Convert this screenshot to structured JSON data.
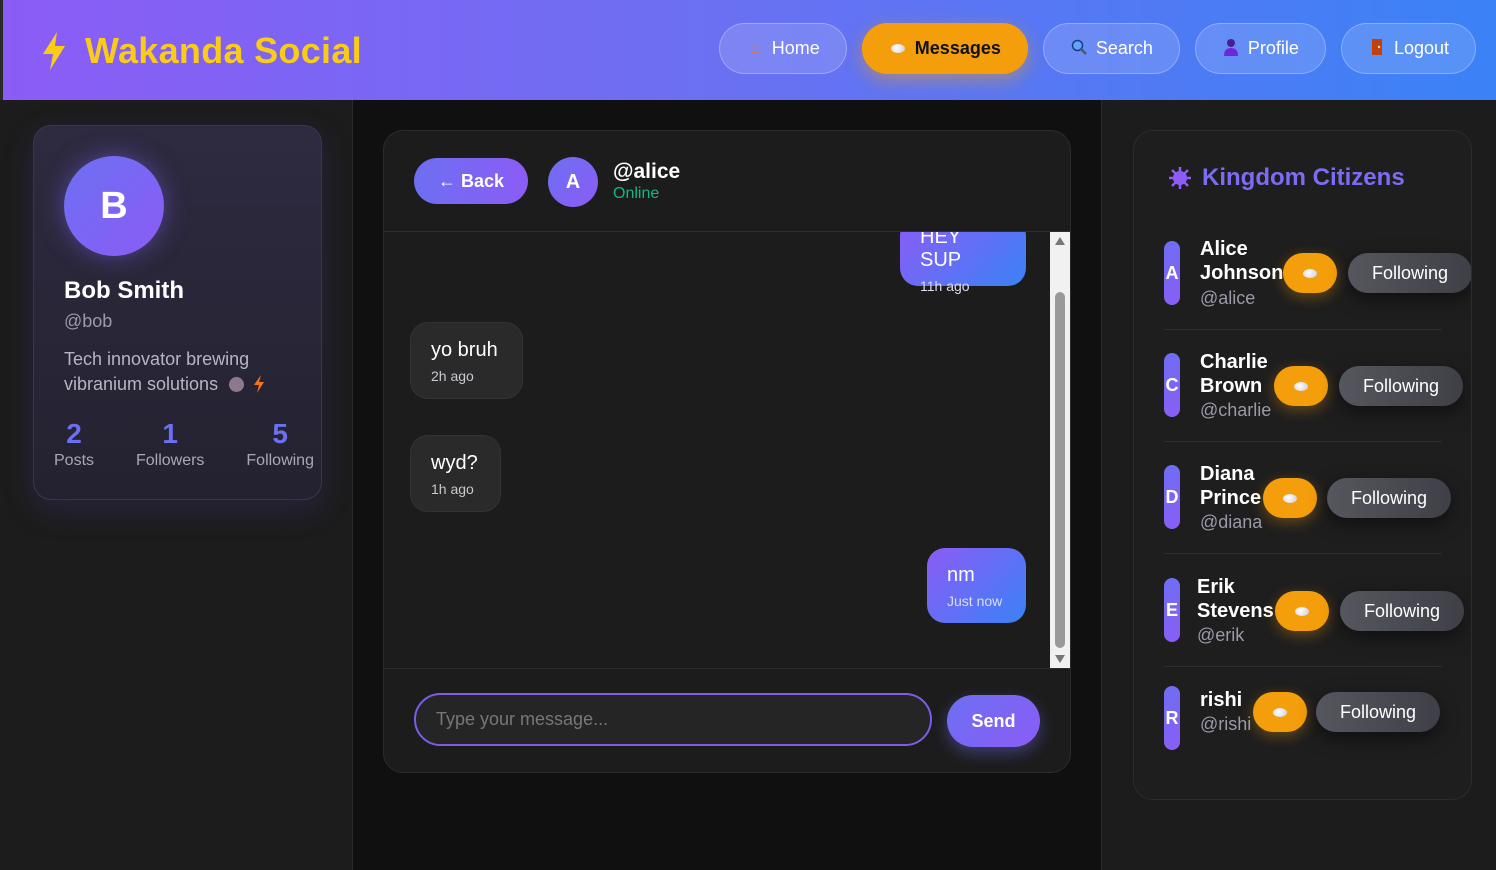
{
  "app": {
    "title": "Wakanda Social"
  },
  "nav": {
    "home": {
      "icon": "house-icon",
      "label": "Home"
    },
    "messages": {
      "icon": "speech-bubble-icon",
      "label": "Messages"
    },
    "search": {
      "icon": "magnifier-icon",
      "label": "Search"
    },
    "profile": {
      "icon": "person-icon",
      "label": "Profile"
    },
    "logout": {
      "icon": "door-icon",
      "label": "Logout"
    }
  },
  "profile": {
    "avatar_letter": "B",
    "name": "Bob Smith",
    "handle": "@bob",
    "bio": "Tech innovator brewing vibranium solutions",
    "stats": {
      "posts": {
        "value": "2",
        "label": "Posts"
      },
      "followers": {
        "value": "1",
        "label": "Followers"
      },
      "following": {
        "value": "5",
        "label": "Following"
      }
    }
  },
  "chat": {
    "back_label": "← Back",
    "avatar_letter": "A",
    "username": "@alice",
    "status": "Online",
    "messages": [
      {
        "direction": "out",
        "text": "HEY SUP",
        "time": "11h ago"
      },
      {
        "direction": "in",
        "text": "yo bruh",
        "time": "2h ago"
      },
      {
        "direction": "in",
        "text": "wyd?",
        "time": "1h ago"
      },
      {
        "direction": "out",
        "text": "nm",
        "time": "Just now"
      }
    ],
    "input_placeholder": "Type your message...",
    "input_value": "",
    "send_label": "Send"
  },
  "citizens": {
    "title": "Kingdom Citizens",
    "list": [
      {
        "letter": "A",
        "name_line1": "Alice",
        "name_line2": "Johnson",
        "handle": "@alice",
        "follow_label": "Following"
      },
      {
        "letter": "C",
        "name_line1": "Charlie",
        "name_line2": "Brown",
        "handle": "@charlie",
        "follow_label": "Following"
      },
      {
        "letter": "D",
        "name_line1": "Diana",
        "name_line2": "Prince",
        "handle": "@diana",
        "follow_label": "Following"
      },
      {
        "letter": "E",
        "name_line1": "Erik",
        "name_line2": "Stevens",
        "handle": "@erik",
        "follow_label": "Following"
      },
      {
        "letter": "R",
        "name_line1": "rishi",
        "name_line2": "",
        "handle": "@rishi",
        "follow_label": "Following"
      }
    ]
  },
  "colors": {
    "brand_yellow": "#facc15",
    "accent_orange": "#f59e0b",
    "accent_purple": "#8b5cf6",
    "accent_blue": "#3b82f6",
    "online_green": "#10b981"
  }
}
